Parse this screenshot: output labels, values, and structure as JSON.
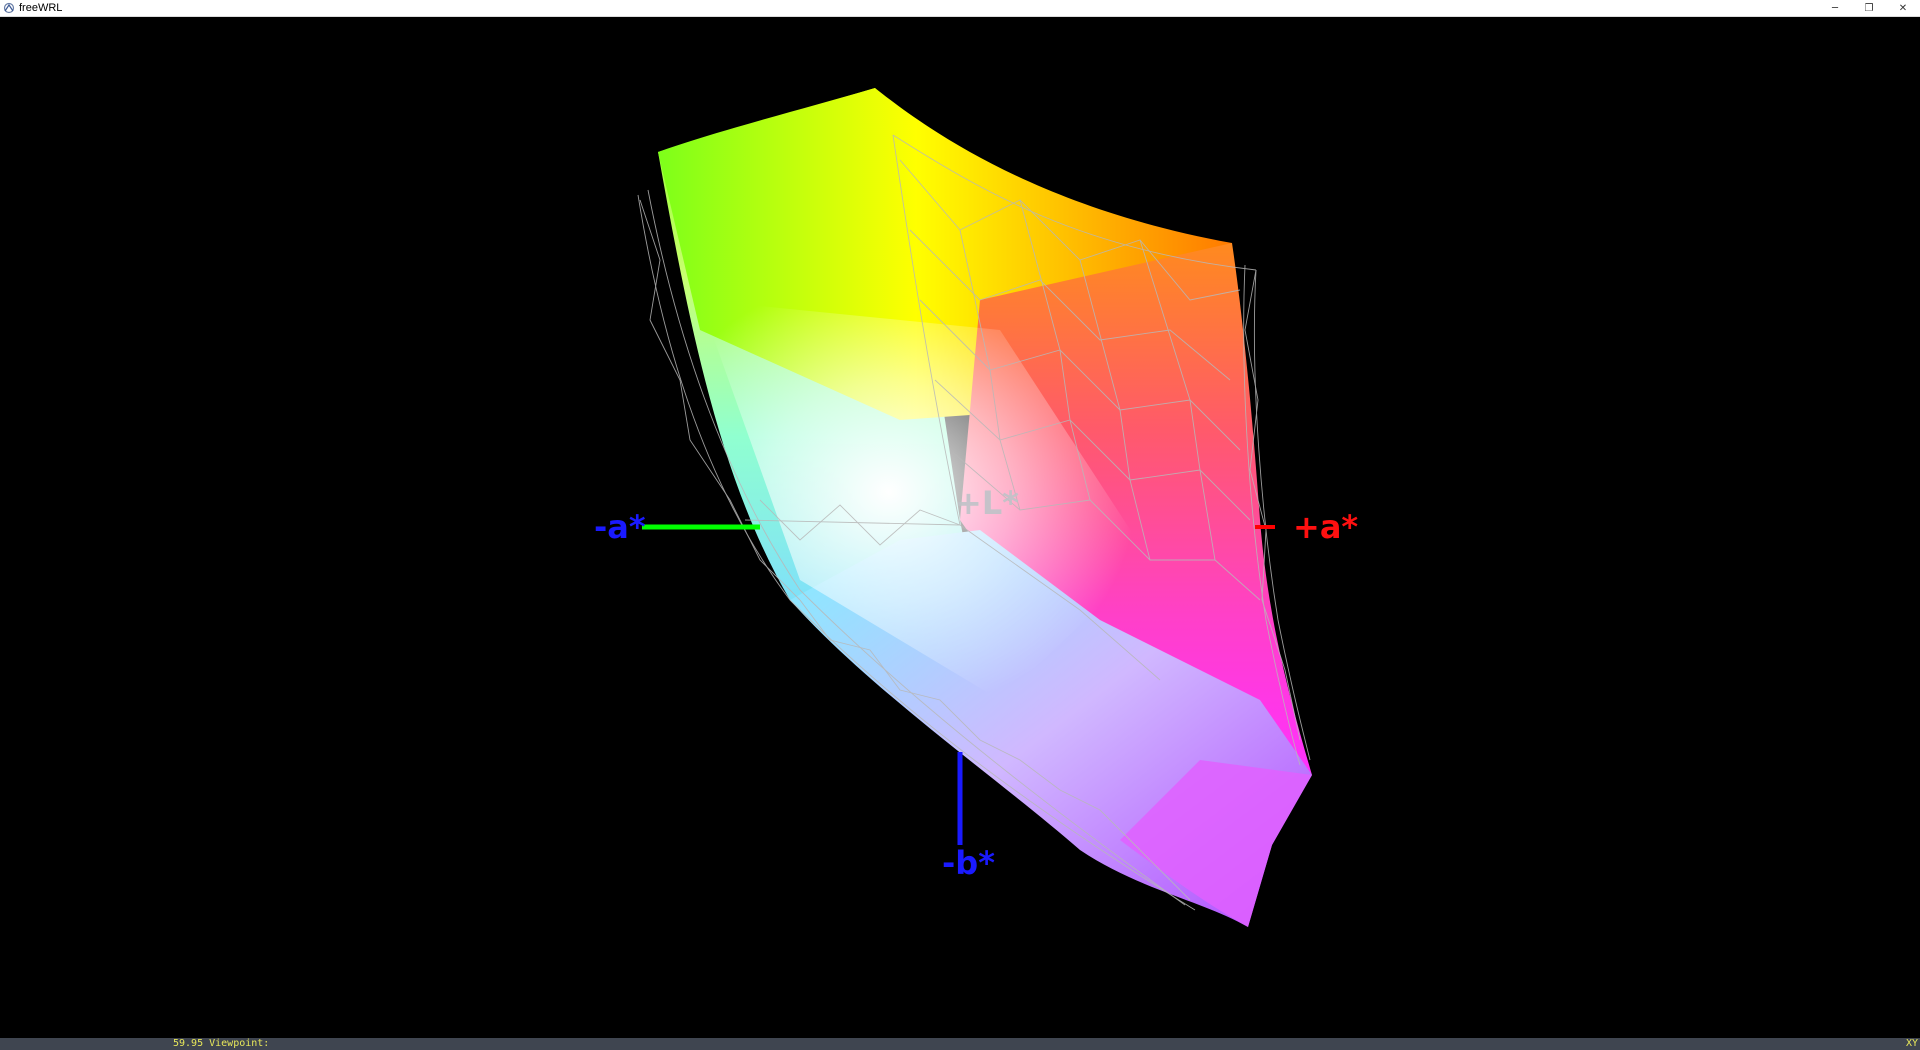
{
  "window": {
    "title": "freeWRL",
    "icon": "freewrl-app-icon",
    "controls": {
      "minimize": "─",
      "restore": "❐",
      "close": "✕"
    }
  },
  "scene": {
    "axes": {
      "neg_a": {
        "label": "-a*",
        "label_color": "#1a1aff",
        "line_color": "#00ff00"
      },
      "pos_a": {
        "label": "+a*",
        "label_color": "#ff1010",
        "line_color": "#ff0000"
      },
      "neg_b": {
        "label": "-b*",
        "label_color": "#1a1aff",
        "line_color": "#1a1aff"
      },
      "pos_l": {
        "label": "+L*",
        "label_color": "#bfc3c8"
      }
    },
    "colors": {
      "background": "#000000",
      "wireframe": "#b8b8b8"
    }
  },
  "statusbar": {
    "left": "59.95 Viewpoint:",
    "right": "XY"
  }
}
